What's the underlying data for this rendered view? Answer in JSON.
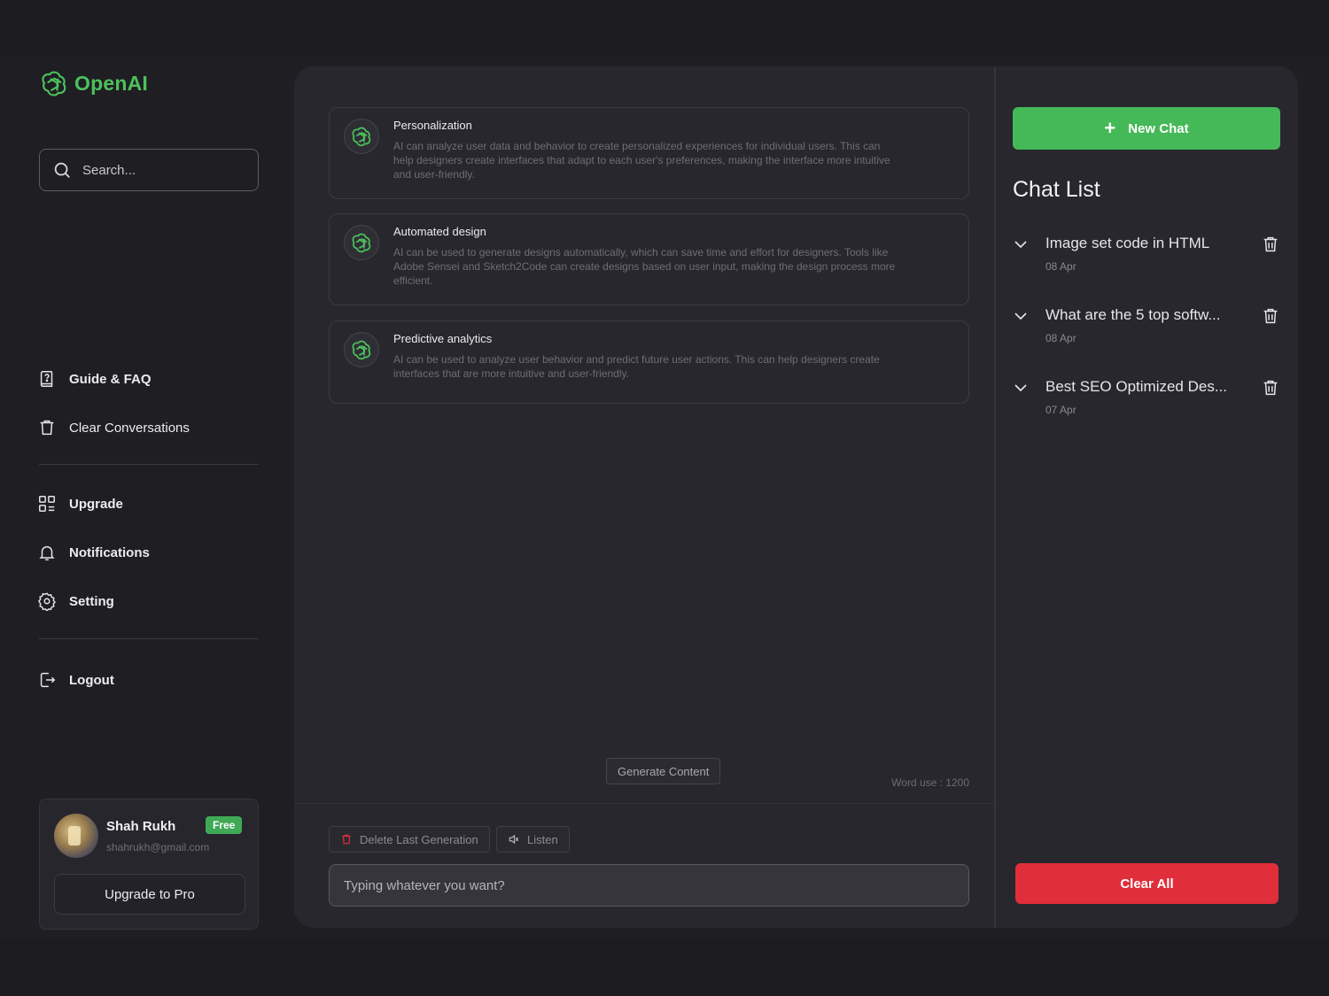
{
  "brand": {
    "name": "OpenAI",
    "color": "#4cc15b"
  },
  "search": {
    "placeholder": "Search..."
  },
  "nav": {
    "guide": "Guide & FAQ",
    "clear_conversations": "Clear Conversations",
    "upgrade": "Upgrade",
    "notifications": "Notifications",
    "setting": "Setting",
    "logout": "Logout"
  },
  "profile": {
    "name": "Shah Rukh",
    "badge": "Free",
    "email": "shahrukh@gmail.com",
    "upgrade_label": "Upgrade to Pro"
  },
  "cards": [
    {
      "title": "Personalization",
      "body": "AI can analyze user data and behavior to create personalized experiences for individual users. This can help designers create interfaces that adapt to each user's preferences, making the interface   more intuitive and user-friendly."
    },
    {
      "title": "Automated design",
      "body": "AI can be used to generate designs automatically, which can save time and effort for designers. Tools like Adobe Sensei and Sketch2Code can create designs based on user input, making the design process more efficient."
    },
    {
      "title": "Predictive analytics",
      "body": "AI can be used to analyze user behavior and predict future user actions. This can help designers create interfaces that are more intuitive and user-friendly."
    }
  ],
  "composer": {
    "generate_label": "Generate Content",
    "word_use": "Word use : 1200",
    "delete_label": "Delete Last Generation",
    "listen_label": "Listen",
    "input_placeholder": "Typing whatever you want?"
  },
  "right": {
    "new_chat_label": "New Chat",
    "chat_list_title": "Chat List",
    "chats": [
      {
        "title": "Image set code in HTML",
        "date": "08 Apr"
      },
      {
        "title": "What are the 5 top softw...",
        "date": "08 Apr"
      },
      {
        "title": "Best SEO Optimized Des...",
        "date": "07 Apr"
      }
    ],
    "clear_all_label": "Clear All"
  },
  "colors": {
    "accent_green": "#45b957",
    "danger_red": "#e12e3b",
    "panel": "#28272e",
    "background": "#1d1c21"
  }
}
